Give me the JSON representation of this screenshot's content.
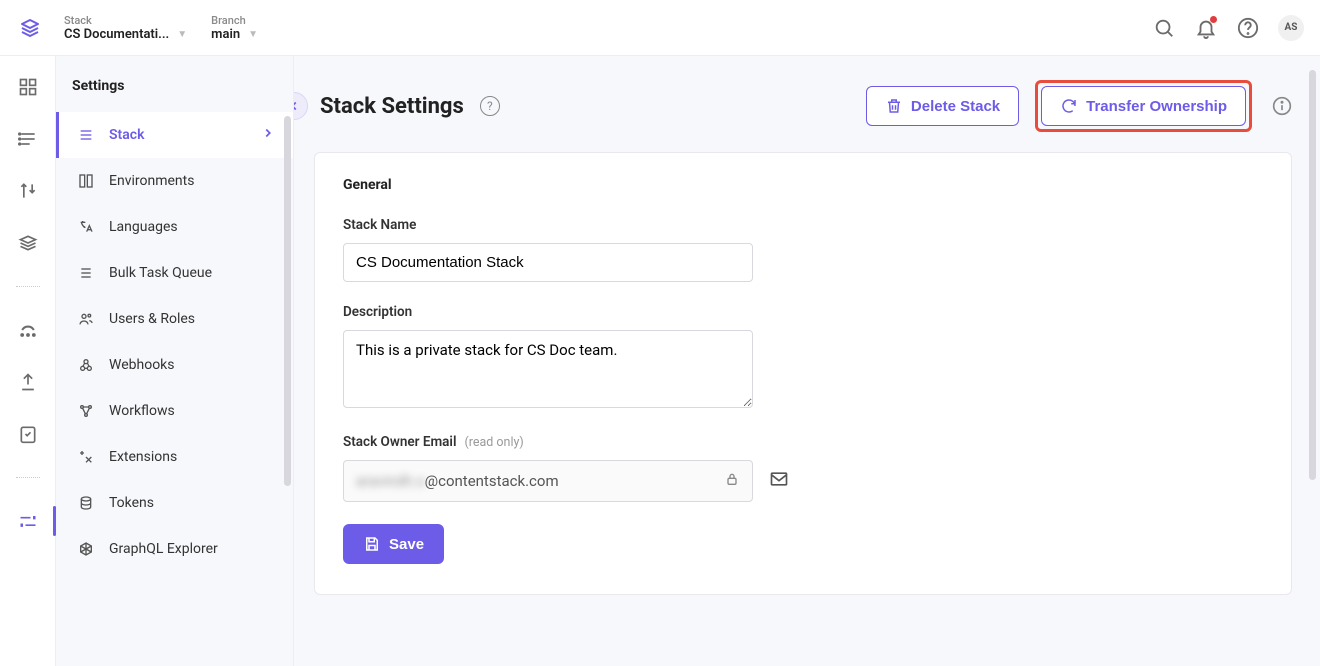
{
  "header": {
    "stack_label": "Stack",
    "stack_value": "CS Documentati...",
    "branch_label": "Branch",
    "branch_value": "main",
    "avatar_initials": "AS"
  },
  "sidebar": {
    "title": "Settings",
    "items": [
      {
        "label": "Stack"
      },
      {
        "label": "Environments"
      },
      {
        "label": "Languages"
      },
      {
        "label": "Bulk Task Queue"
      },
      {
        "label": "Users & Roles"
      },
      {
        "label": "Webhooks"
      },
      {
        "label": "Workflows"
      },
      {
        "label": "Extensions"
      },
      {
        "label": "Tokens"
      },
      {
        "label": "GraphQL Explorer"
      }
    ]
  },
  "page": {
    "title": "Stack Settings",
    "delete_label": "Delete Stack",
    "transfer_label": "Transfer Ownership"
  },
  "form": {
    "section_general": "General",
    "name_label": "Stack Name",
    "name_value": "CS Documentation Stack",
    "desc_label": "Description",
    "desc_value": "This is a private stack for CS Doc team.",
    "owner_label": "Stack Owner Email",
    "owner_hint": "(read only)",
    "owner_prefix_blurred": "aravindh.s",
    "owner_suffix": "@contentstack.com",
    "save_label": "Save"
  }
}
